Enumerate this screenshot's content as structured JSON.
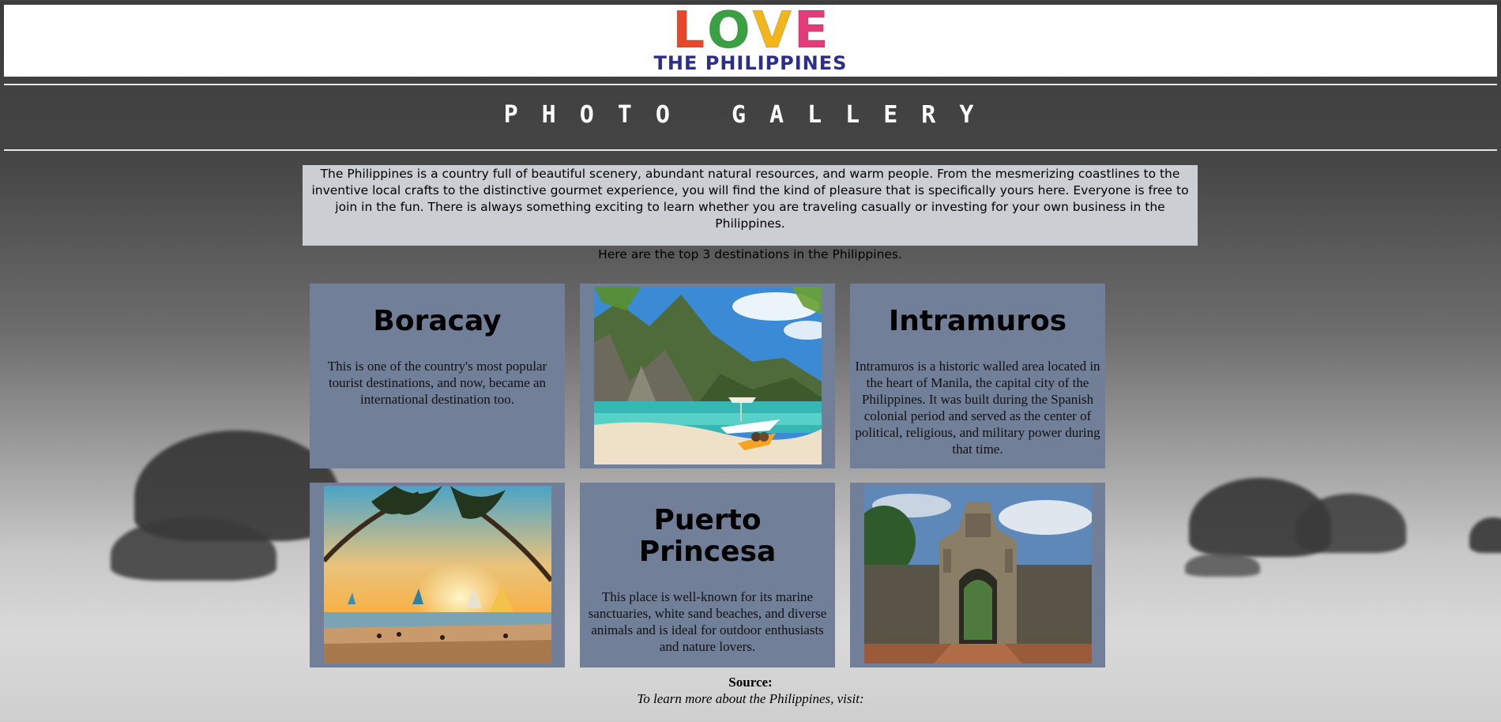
{
  "logo": {
    "letters": [
      "L",
      "O",
      "V",
      "E"
    ],
    "subtitle": "THE PHILIPPINES",
    "colors": [
      "#e8472b",
      "#3aa142",
      "#f2b51b",
      "#e63b7a"
    ]
  },
  "page_title": "PHOTO GALLERY",
  "intro": {
    "paragraph": "The Philippines is a country full of beautiful scenery, abundant natural resources, and warm people. From the mesmerizing coastlines to the inventive local crafts to the distinctive gourmet experience, you will find the kind of pleasure that is specifically yours here. Everyone is free to join in the fun. There is always something exciting to learn whether you are traveling casually or investing for your own business in the Philippines.",
    "lead": "Here are the top 3 destinations in the Philippines."
  },
  "destinations": [
    {
      "title": "Boracay",
      "text": "This is one of the country's most popular tourist destinations, and now, became an international destination too."
    },
    {
      "title": "Intramuros",
      "text": "Intramuros is a historic walled area located in the heart of Manila, the capital city of the Philippines. It was built during the Spanish colonial period and served as the center of political, religious, and military power during that time."
    },
    {
      "title": "Puerto Princesa",
      "text": "This place is well-known for its marine sanctuaries, white sand beaches, and diverse animals and is ideal for outdoor enthusiasts and nature lovers."
    }
  ],
  "source": {
    "label": "Source:",
    "text": "To learn more about the Philippines, visit:"
  },
  "colors": {
    "card_bg": "#717f99",
    "intro_bg": "#cbcfd3"
  }
}
